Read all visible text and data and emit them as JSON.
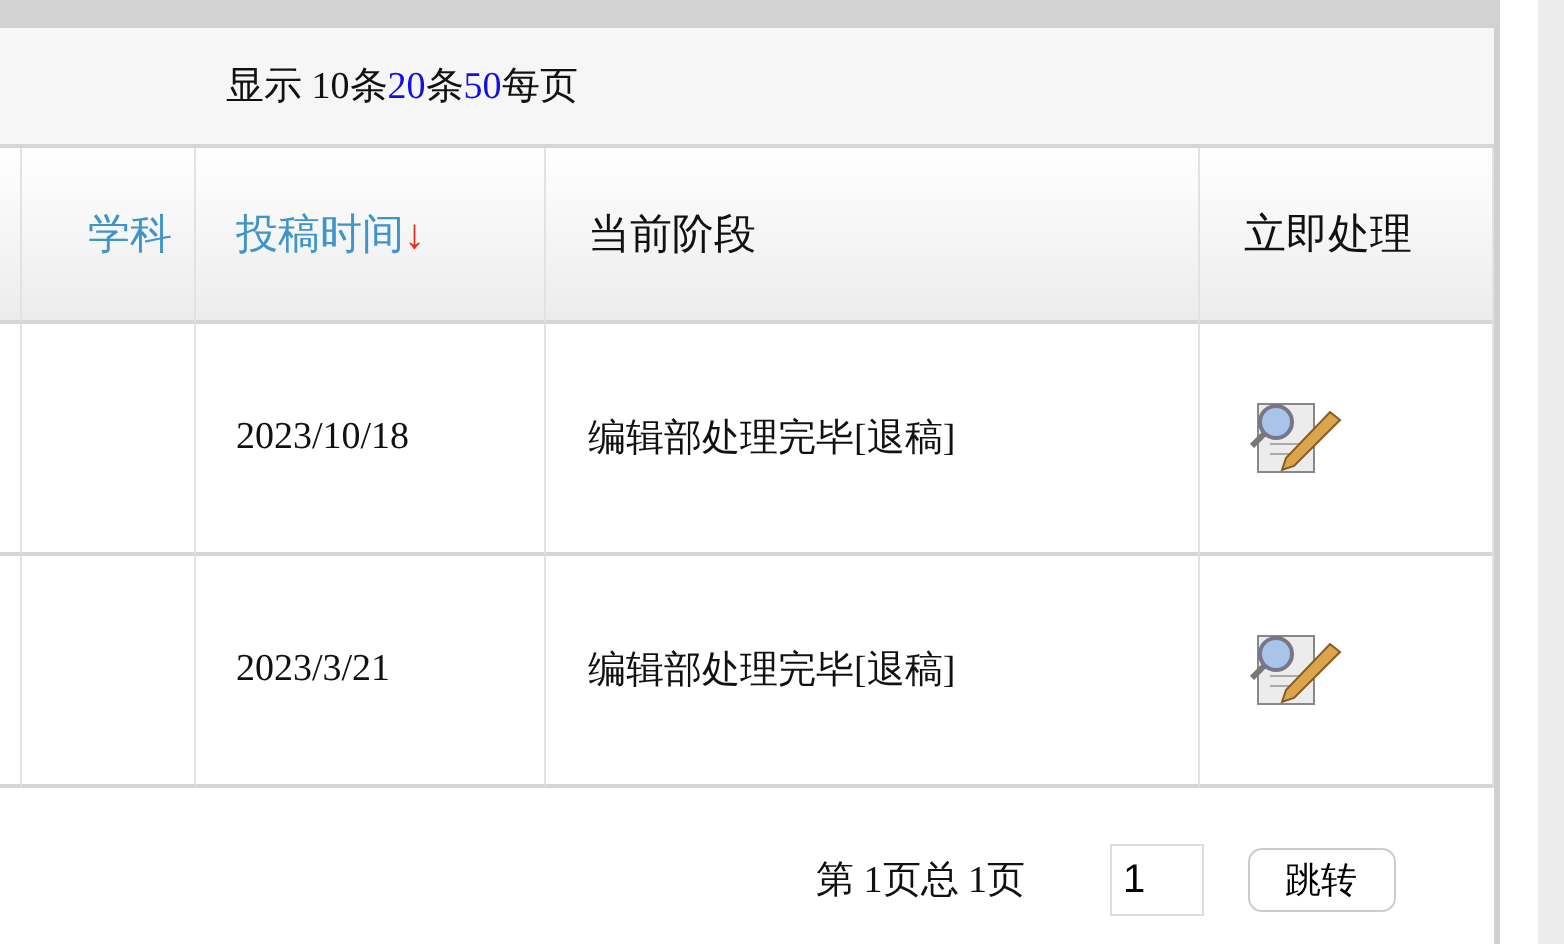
{
  "page_size": {
    "segments": [
      {
        "kind": "text",
        "text": "显示 10条"
      },
      {
        "kind": "link",
        "text": "20"
      },
      {
        "kind": "text",
        "text": "条"
      },
      {
        "kind": "link",
        "text": "50"
      },
      {
        "kind": "text",
        "text": "每页"
      }
    ]
  },
  "table": {
    "columns": [
      {
        "label": "学科",
        "kind": "link"
      },
      {
        "label": "投稿时间",
        "kind": "link",
        "sort_mark": "↓"
      },
      {
        "label": "当前阶段",
        "kind": "plain"
      },
      {
        "label": "立即处理",
        "kind": "plain"
      }
    ],
    "rows": [
      {
        "date": "2023/10/18",
        "stage": "编辑部处理完毕[退稿]"
      },
      {
        "date": "2023/3/21",
        "stage": "编辑部处理完毕[退稿]"
      }
    ]
  },
  "pagination": {
    "info": "第 1页总 1页",
    "page_input": "1",
    "jump_button": "跳转"
  }
}
